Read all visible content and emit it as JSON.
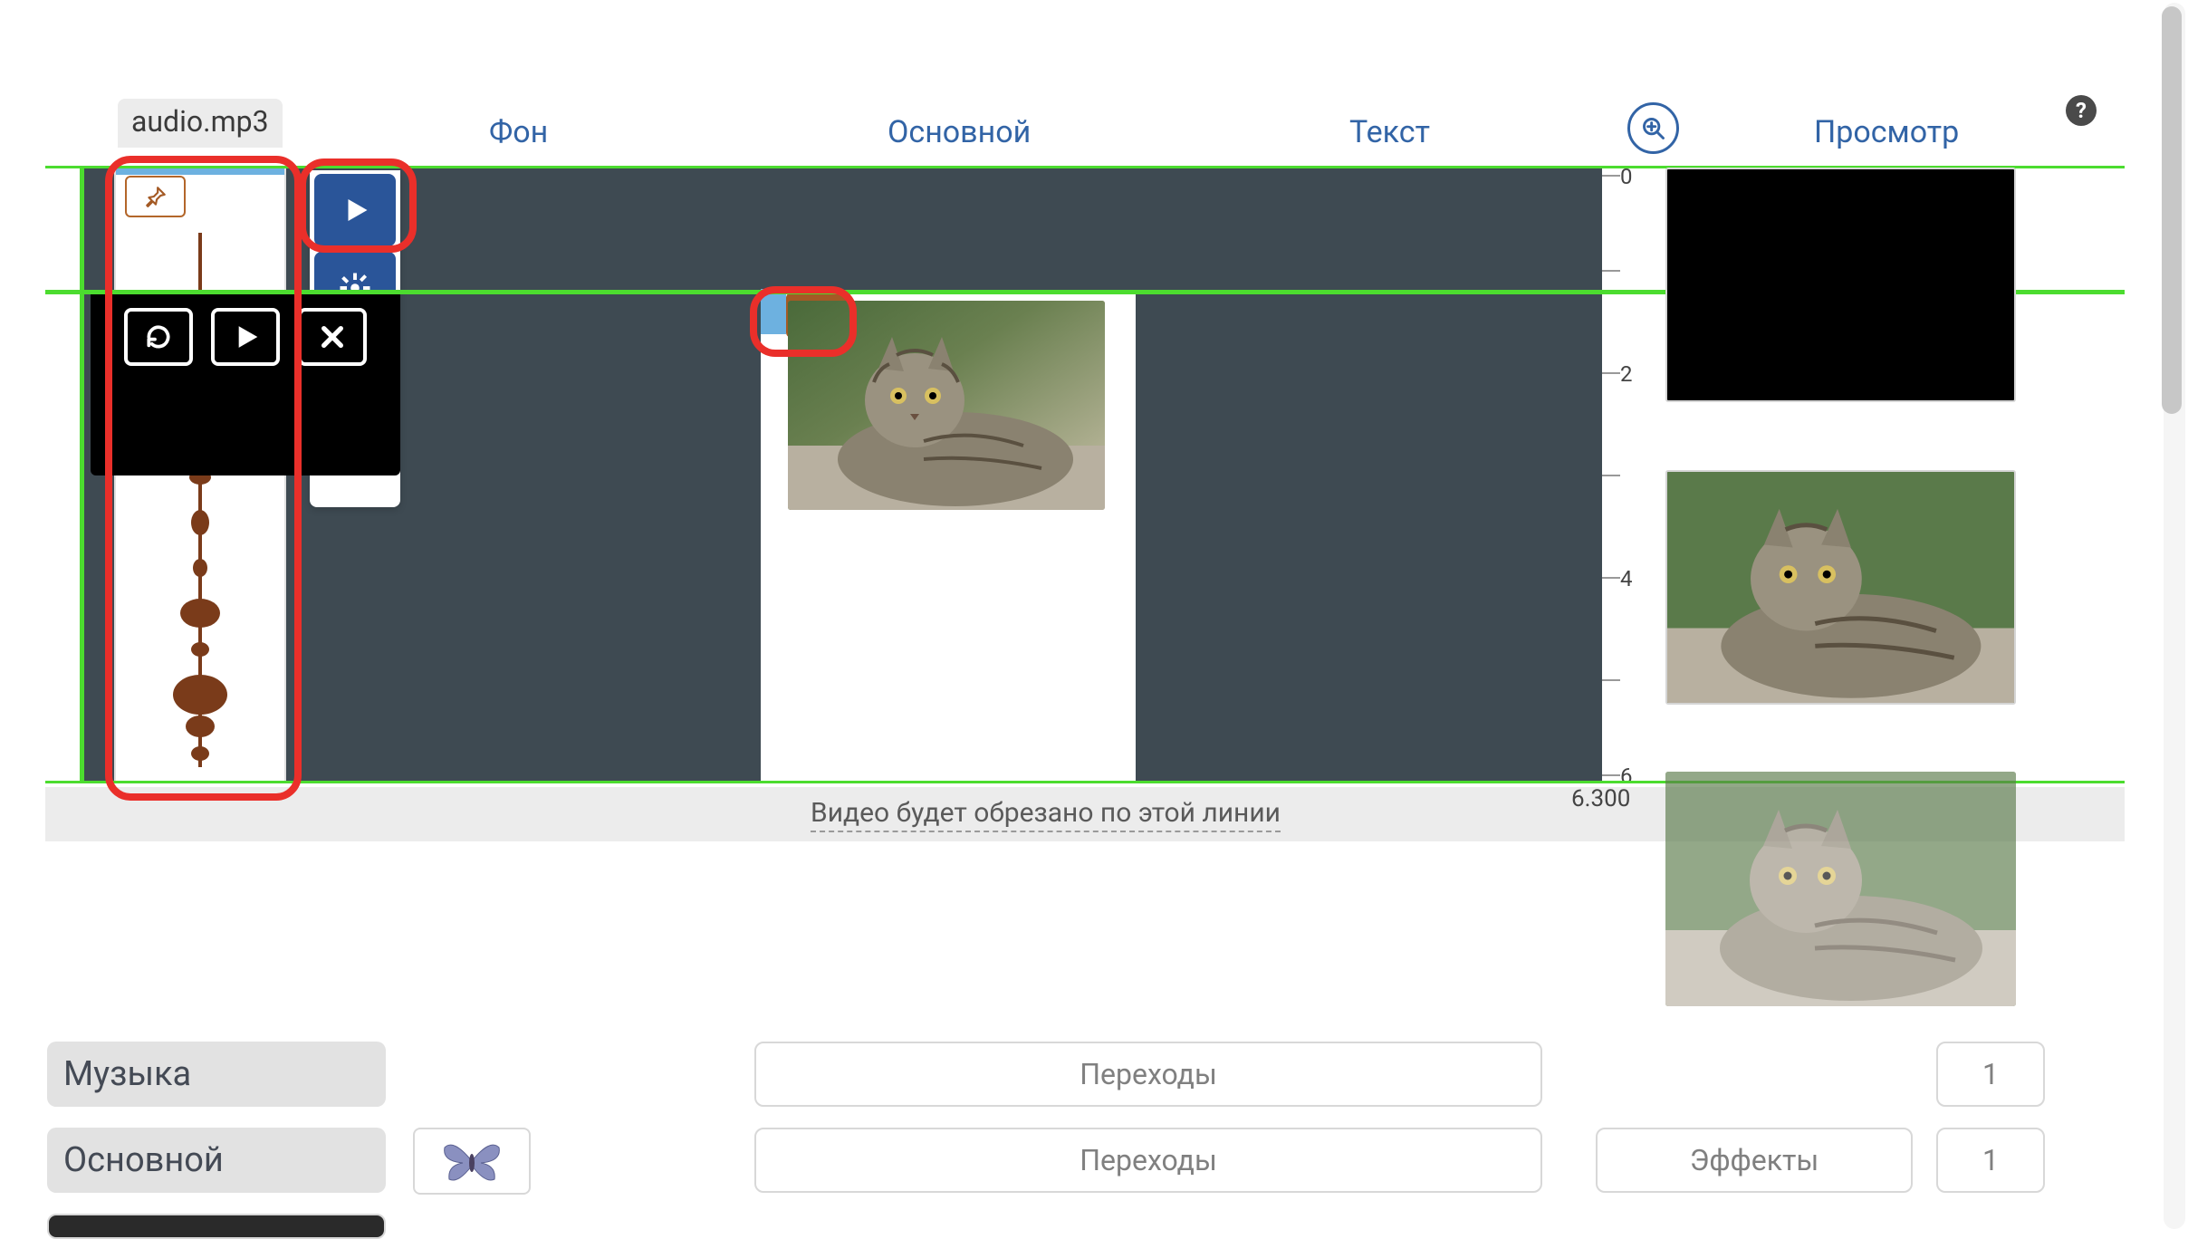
{
  "tabs": {
    "audio_file": "audio.mp3",
    "background": "Фон",
    "main": "Основной",
    "text": "Текст",
    "preview": "Просмотр"
  },
  "timeline": {
    "ticks": [
      "0",
      "2",
      "4",
      "6"
    ],
    "crop_line_text": "Видео будет обрезано по этой линии",
    "end_time": "6.300"
  },
  "side_buttons": {
    "play": "play",
    "settings": "settings",
    "reset_or_trash": "reset",
    "help": "?"
  },
  "popup": {
    "refresh": "refresh",
    "play": "play",
    "close": "close"
  },
  "bottom": {
    "music_label": "Музыка",
    "main_label": "Основной",
    "transitions": "Переходы",
    "effects": "Эффекты",
    "music_count": "1",
    "main_count": "1"
  },
  "icons": {
    "zoom": "zoom-in",
    "help": "?",
    "pin": "pin"
  }
}
